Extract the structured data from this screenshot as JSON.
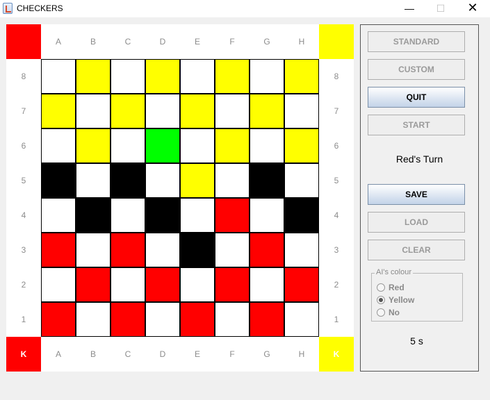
{
  "window": {
    "title": "CHECKERS",
    "minimize_glyph": "—",
    "maximize_glyph": "☐",
    "close_glyph": "✕",
    "icon": "java-app-icon"
  },
  "colors": {
    "red": "#ff0000",
    "yellow": "#ffff00",
    "black": "#000000",
    "white": "#ffffff",
    "green": "#00ff00"
  },
  "board": {
    "columns": [
      "A",
      "B",
      "C",
      "D",
      "E",
      "F",
      "G",
      "H"
    ],
    "rows": [
      "8",
      "7",
      "6",
      "5",
      "4",
      "3",
      "2",
      "1"
    ],
    "corner_top_left": {
      "color": "red",
      "label": ""
    },
    "corner_top_right": {
      "color": "yellow",
      "label": ""
    },
    "corner_bottom_left": {
      "color": "red",
      "label": "K"
    },
    "corner_bottom_right": {
      "color": "yellow",
      "label": "K"
    },
    "squares": [
      [
        "white",
        "yellow",
        "white",
        "yellow",
        "white",
        "yellow",
        "white",
        "yellow"
      ],
      [
        "yellow",
        "white",
        "yellow",
        "white",
        "yellow",
        "white",
        "yellow",
        "white"
      ],
      [
        "white",
        "yellow",
        "white",
        "green",
        "white",
        "yellow",
        "white",
        "yellow"
      ],
      [
        "black",
        "white",
        "black",
        "white",
        "yellow",
        "white",
        "black",
        "white"
      ],
      [
        "white",
        "black",
        "white",
        "black",
        "white",
        "red",
        "white",
        "black"
      ],
      [
        "red",
        "white",
        "red",
        "white",
        "black",
        "white",
        "red",
        "white"
      ],
      [
        "white",
        "red",
        "white",
        "red",
        "white",
        "red",
        "white",
        "red"
      ],
      [
        "red",
        "white",
        "red",
        "white",
        "red",
        "white",
        "red",
        "white"
      ]
    ]
  },
  "panel": {
    "buttons": {
      "standard": "STANDARD",
      "custom": "CUSTOM",
      "quit": "QUIT",
      "start": "START",
      "save": "SAVE",
      "load": "LOAD",
      "clear": "CLEAR"
    },
    "turn_text": "Red's Turn",
    "ai_colour": {
      "legend": "AI's colour",
      "options": [
        "Red",
        "Yellow",
        "No"
      ],
      "selected": "Yellow"
    },
    "timer": "5 s"
  }
}
